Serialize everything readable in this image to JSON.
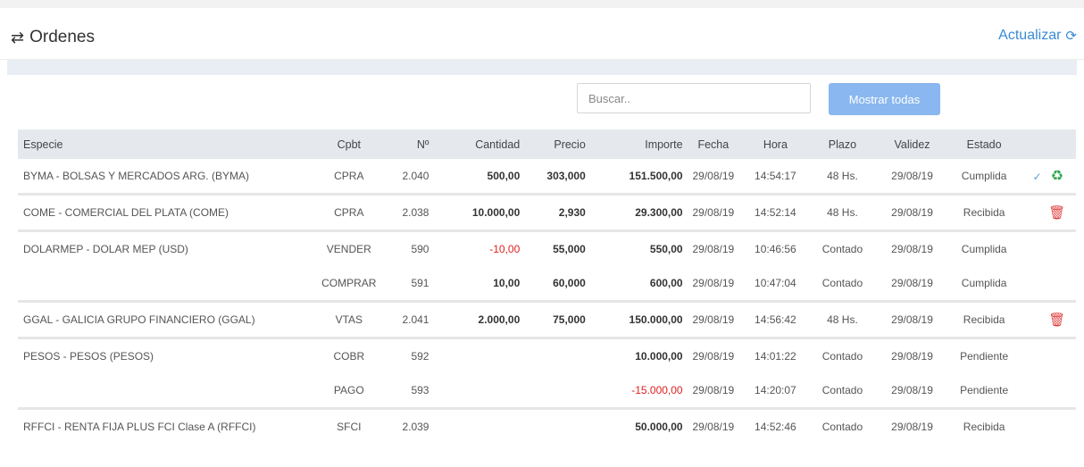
{
  "header": {
    "title": "Ordenes",
    "refresh_label": "Actualizar"
  },
  "search": {
    "placeholder": "Buscar.."
  },
  "show_all_label": "Mostrar todas",
  "columns": [
    "Especie",
    "Cpbt",
    "Nº",
    "Cantidad",
    "Precio",
    "Importe",
    "Fecha",
    "Hora",
    "Plazo",
    "Validez",
    "Estado"
  ],
  "rows": [
    {
      "especie": "BYMA - BOLSAS Y MERCADOS ARG. (BYMA)",
      "cpbt": "CPRA",
      "num": "2.040",
      "cantidad": "500,00",
      "precio": "303,000",
      "importe": "151.500,00",
      "fecha": "29/08/19",
      "hora": "14:54:17",
      "plazo": "48 Hs.",
      "validez": "29/08/19",
      "estado": "Cumplida"
    },
    {
      "especie": "COME - COMERCIAL DEL PLATA (COME)",
      "cpbt": "CPRA",
      "num": "2.038",
      "cantidad": "10.000,00",
      "precio": "2,930",
      "importe": "29.300,00",
      "fecha": "29/08/19",
      "hora": "14:52:14",
      "plazo": "48 Hs.",
      "validez": "29/08/19",
      "estado": "Recibida"
    },
    {
      "especie": "DOLARMEP - DOLAR MEP (USD)",
      "cpbt": "VENDER",
      "num": "590",
      "cantidad": "-10,00",
      "precio": "55,000",
      "importe": "550,00",
      "fecha": "29/08/19",
      "hora": "10:46:56",
      "plazo": "Contado",
      "validez": "29/08/19",
      "estado": "Cumplida"
    },
    {
      "especie": "",
      "cpbt": "COMPRAR",
      "num": "591",
      "cantidad": "10,00",
      "precio": "60,000",
      "importe": "600,00",
      "fecha": "29/08/19",
      "hora": "10:47:04",
      "plazo": "Contado",
      "validez": "29/08/19",
      "estado": "Cumplida"
    },
    {
      "especie": "GGAL - GALICIA GRUPO FINANCIERO (GGAL)",
      "cpbt": "VTAS",
      "num": "2.041",
      "cantidad": "2.000,00",
      "precio": "75,000",
      "importe": "150.000,00",
      "fecha": "29/08/19",
      "hora": "14:56:42",
      "plazo": "48 Hs.",
      "validez": "29/08/19",
      "estado": "Recibida"
    },
    {
      "especie": "PESOS - PESOS (PESOS)",
      "cpbt": "COBR",
      "num": "592",
      "cantidad": "",
      "precio": "",
      "importe": "10.000,00",
      "fecha": "29/08/19",
      "hora": "14:01:22",
      "plazo": "Contado",
      "validez": "29/08/19",
      "estado": "Pendiente"
    },
    {
      "especie": "",
      "cpbt": "PAGO",
      "num": "593",
      "cantidad": "",
      "precio": "",
      "importe": "-15.000,00",
      "fecha": "29/08/19",
      "hora": "14:20:07",
      "plazo": "Contado",
      "validez": "29/08/19",
      "estado": "Pendiente"
    },
    {
      "especie": "RFFCI - RENTA FIJA PLUS FCI Clase A (RFFCI)",
      "cpbt": "SFCI",
      "num": "2.039",
      "cantidad": "",
      "precio": "",
      "importe": "50.000,00",
      "fecha": "29/08/19",
      "hora": "14:52:46",
      "plazo": "Contado",
      "validez": "29/08/19",
      "estado": "Recibida"
    }
  ],
  "colors": {
    "accent": "#3a8ad4",
    "button": "#8ab7ef",
    "negative": "#e02020",
    "delete": "#e04040",
    "recycle": "#2fa84f"
  },
  "icons": {
    "title": "swap-icon",
    "refresh": "sync-icon",
    "expand": "chevron-down-icon",
    "reprocess": "recycle-icon",
    "delete": "trash-icon"
  }
}
